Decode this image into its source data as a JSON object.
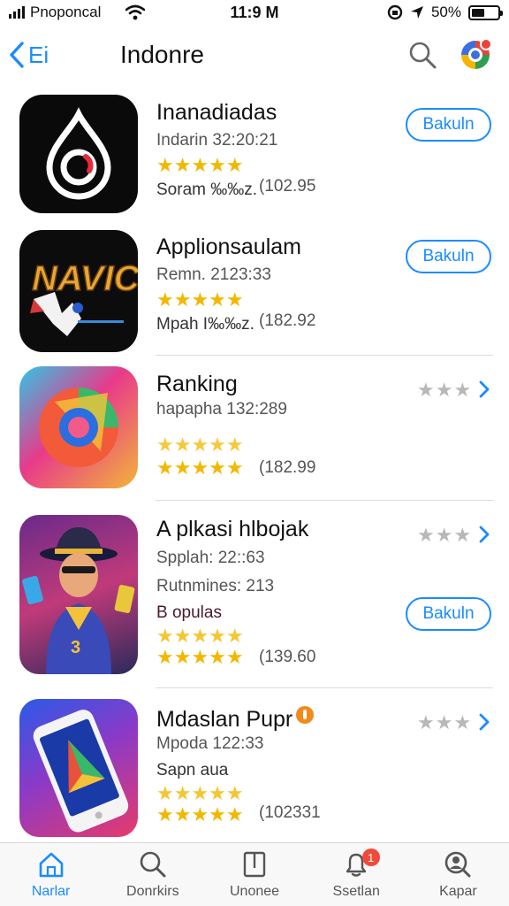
{
  "status_bar": {
    "carrier": "Pnoponcal",
    "time": "11:9 M",
    "battery_text": "50%",
    "battery_level": 0.5
  },
  "nav": {
    "back_label": "Ei",
    "title": "Indonre"
  },
  "colors": {
    "accent": "#1a8cff",
    "star_gold": "#f2b800",
    "star_grey": "#b8b8b8",
    "badge_red": "#f04a3a",
    "badge_orange": "#f08a1c"
  },
  "apps": [
    {
      "name": "Inanadiadas",
      "line1": "Indarin 32:20:21",
      "stars": "★★★★★",
      "line2": "Soram ‰‰z.",
      "count": "(102.95",
      "button": "Bakuln",
      "icon": "droplet-ring-icon"
    },
    {
      "name": "Applionsaulam",
      "line1": "Remn. 2123:33",
      "stars": "★★★★★",
      "line2": "Mpah I‰‰z.",
      "count": "(182.92",
      "button": "Bakuln",
      "icon": "game-logo-icon"
    },
    {
      "name": "Ranking",
      "line1": "hapapha 132:289",
      "stars_top": "★★★★★",
      "stars": "★★★★★",
      "count": "(182.99",
      "grey_stars": "★★★",
      "icon": "colorful-swirl-icon"
    },
    {
      "name": "A plkasi hlbojak",
      "line1": "Spplah: 22::63",
      "line2": "Rutnmines: 213",
      "line3": "B opulas",
      "stars_top": "★★★★★",
      "stars": "★★★★★",
      "count": "(139.60",
      "grey_stars": "★★★",
      "button": "Bakuln",
      "icon": "character-hat-icon"
    },
    {
      "name": "Mdaslan Pupr",
      "line1": "Mpoda 122:33",
      "line2": "Sapn aua",
      "stars_top": "★★★★★",
      "stars": "★★★★★",
      "count": "(102331",
      "grey_stars": "★★★",
      "icon": "phone-icon"
    }
  ],
  "tabs": [
    {
      "label": "Narlar",
      "icon": "home-icon"
    },
    {
      "label": "Donrkirs",
      "icon": "search-icon"
    },
    {
      "label": "Unonee",
      "icon": "book-icon"
    },
    {
      "label": "Ssetlan",
      "icon": "bell-icon",
      "badge": "1"
    },
    {
      "label": "Kapar",
      "icon": "profile-search-icon"
    }
  ]
}
